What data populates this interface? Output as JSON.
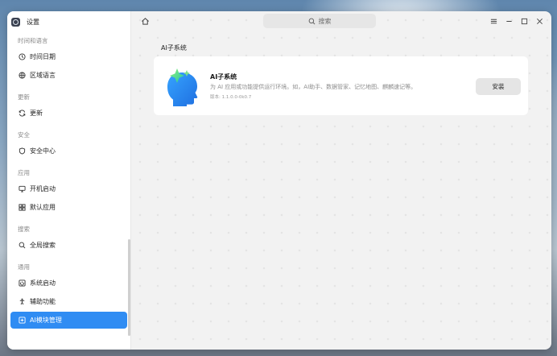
{
  "app": {
    "title": "设置"
  },
  "sidebar": {
    "groups": [
      {
        "title": "时间和语言",
        "items": [
          {
            "label": "时间日期",
            "icon": "clock-icon"
          },
          {
            "label": "区域语言",
            "icon": "globe-icon"
          }
        ]
      },
      {
        "title": "更新",
        "items": [
          {
            "label": "更新",
            "icon": "refresh-icon"
          }
        ]
      },
      {
        "title": "安全",
        "items": [
          {
            "label": "安全中心",
            "icon": "shield-icon"
          }
        ]
      },
      {
        "title": "应用",
        "items": [
          {
            "label": "开机启动",
            "icon": "monitor-icon"
          },
          {
            "label": "默认应用",
            "icon": "grid-icon"
          }
        ]
      },
      {
        "title": "搜索",
        "items": [
          {
            "label": "全局搜索",
            "icon": "search-icon"
          }
        ]
      },
      {
        "title": "通用",
        "items": [
          {
            "label": "系统启动",
            "icon": "power-box-icon"
          },
          {
            "label": "辅助功能",
            "icon": "accessibility-icon"
          },
          {
            "label": "AI模块管理",
            "icon": "ai-module-icon",
            "active": true
          }
        ]
      }
    ]
  },
  "topbar": {
    "search_placeholder": "搜索"
  },
  "main": {
    "section_title": "AI子系统",
    "card": {
      "name": "AI子系统",
      "description": "为 AI 应用或功能提供运行环境。如，AI助手、数据管家、记忆地图、麒麟速记等。",
      "version": "版本: 1.1.0.0-0k0.7",
      "install_label": "安装"
    }
  },
  "colors": {
    "accent": "#2f8cf3",
    "sidebar_bg": "#ffffff",
    "content_bg": "#f2f2f2"
  }
}
